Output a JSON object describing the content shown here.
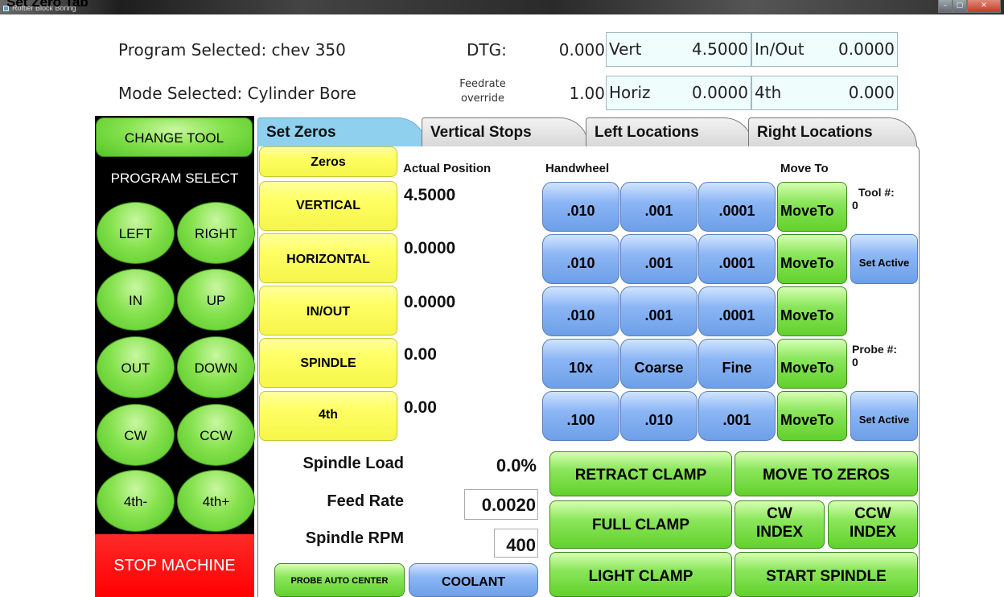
{
  "window": {
    "caption": "Set Zero Tab",
    "title": "Rottler Block Boring",
    "controls": [
      "–",
      "▢",
      "✕"
    ]
  },
  "header": {
    "program_label": "Program Selected: chev 350",
    "mode_label": "Mode Selected: Cylinder Bore",
    "dtg_label": "DTG:",
    "dtg_value": "0.000",
    "feed_override_label_1": "Feedrate",
    "feed_override_label_2": "override",
    "feed_override_value": "1.00",
    "positions": {
      "vert_label": "Vert",
      "vert_value": "4.5000",
      "inout_label": "In/Out",
      "inout_value": "0.0000",
      "horiz_label": "Horiz",
      "horiz_value": "0.0000",
      "fourth_label": "4th",
      "fourth_value": "0.000"
    }
  },
  "sidebar": {
    "change_tool": "CHANGE TOOL",
    "program_select": "PROGRAM SELECT",
    "buttons": [
      {
        "label": "LEFT"
      },
      {
        "label": "RIGHT"
      },
      {
        "label": "IN"
      },
      {
        "label": "UP"
      },
      {
        "label": "OUT"
      },
      {
        "label": "DOWN"
      },
      {
        "label": "CW"
      },
      {
        "label": "CCW"
      },
      {
        "label": "4th-"
      },
      {
        "label": "4th+"
      }
    ],
    "stop": "STOP MACHINE"
  },
  "tabs": [
    {
      "label": "Set Zeros",
      "active": true
    },
    {
      "label": "Vertical Stops",
      "active": false
    },
    {
      "label": "Left Locations",
      "active": false
    },
    {
      "label": "Right Locations",
      "active": false
    }
  ],
  "zeros": {
    "header_button": "Zeros",
    "actual_position_label": "Actual Position",
    "handwheel_label": "Handwheel",
    "move_to_label": "Move To",
    "rows": [
      {
        "axis": "VERTICAL",
        "position": "4.5000",
        "hw": [
          ".010",
          ".001",
          ".0001"
        ],
        "move": "MoveTo"
      },
      {
        "axis": "HORIZONTAL",
        "position": "0.0000",
        "hw": [
          ".010",
          ".001",
          ".0001"
        ],
        "move": "MoveTo"
      },
      {
        "axis": "IN/OUT",
        "position": "0.0000",
        "hw": [
          ".010",
          ".001",
          ".0001"
        ],
        "move": "MoveTo"
      },
      {
        "axis": "SPINDLE",
        "position": "0.00",
        "hw": [
          "10x",
          "Coarse",
          "Fine"
        ],
        "move": "MoveTo"
      },
      {
        "axis": "4th",
        "position": "0.00",
        "hw": [
          ".100",
          ".010",
          ".001"
        ],
        "move": "MoveTo"
      }
    ],
    "tool_label": "Tool #:",
    "tool_value": "0",
    "probe_label": "Probe #:",
    "probe_value": "0",
    "set_active": "Set Active"
  },
  "status": {
    "spindle_load_label": "Spindle Load",
    "spindle_load_value": "0.0%",
    "feed_rate_label": "Feed Rate",
    "feed_rate_value": "0.0020",
    "spindle_rpm_label": "Spindle RPM",
    "spindle_rpm_value": "400"
  },
  "actions": {
    "retract_clamp": "RETRACT CLAMP",
    "move_to_zeros": "MOVE TO ZEROS",
    "full_clamp": "FULL CLAMP",
    "cw_index_1": "CW",
    "cw_index_2": "INDEX",
    "ccw_index_1": "CCW",
    "ccw_index_2": "INDEX",
    "light_clamp": "LIGHT CLAMP",
    "start_spindle": "START SPINDLE",
    "probe_auto_center": "PROBE AUTO CENTER",
    "coolant": "COOLANT"
  },
  "colors": {
    "accent_green": "#62d12c",
    "accent_blue": "#6d9fe8",
    "accent_yellow": "#ffff66",
    "stop_red": "#ff0000",
    "active_tab": "#8fd0ee"
  }
}
